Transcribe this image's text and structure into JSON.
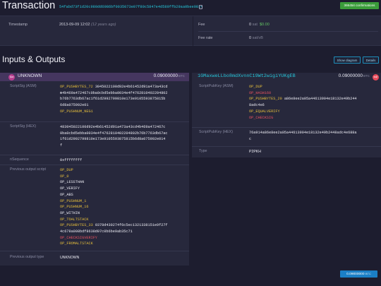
{
  "header": {
    "title": "Transaction",
    "txid": "54fabd73f1d20c980dd6986bf0035073e07f80c5847e4d589ffb29aa0bee9814",
    "confirmations": "366454 confirmations"
  },
  "summary": {
    "timestamp_label": "Timestamp",
    "timestamp_value": "2013-09-09 12:02",
    "timestamp_ago": "(12 years ago)",
    "fee_label": "Fee",
    "fee_sat": "0",
    "fee_sat_unit": "sat",
    "fee_usd": "$0.00",
    "fee_rate_label": "Fee rate",
    "fee_rate_value": "0",
    "fee_rate_unit": "sat/vB"
  },
  "io": {
    "title": "Inputs & Outputs",
    "show_diagram": "Show diagram",
    "details": "Details"
  },
  "input": {
    "label": "UNKNOWN",
    "amount": "0.09000000",
    "unit": "BTC",
    "scriptsig_asm_label": "ScriptSig (ASM)",
    "scriptsig_asm": [
      {
        "text": "OP_PUSHBYTES_72",
        "color": "yellow",
        "rest": " 3045022100d92e4b61452d91a473a43cd"
      },
      {
        "text": "",
        "color": "white",
        "rest": "m4b469a472467c0ba0cbd5ebba0034e4f4762810402204802"
      },
      {
        "text": "",
        "color": "white",
        "rest": "b76b7763db67ac1f61d2992799810e173e9105593875815b"
      },
      {
        "text": "",
        "color": "white",
        "rest": "6d8a075902e01"
      },
      {
        "text": "OP_PUSHNUM_NEG1",
        "color": "yellow",
        "rest": ""
      }
    ],
    "scriptsig_hex_label": "ScriptSig (HEX)",
    "scriptsig_hex": [
      "483045022100d92e4b61452d91a473a43cd4b469a472467c",
      "0ba0cbd5ebba0034e4f4762810402204802b76b7763db67ac",
      "1f61d2992799810e173e9105593875815b6d8a075902e014",
      "f"
    ],
    "nsequence_label": "nSequence",
    "nsequence": "0xffffffff",
    "prevout_label": "Previous output script",
    "prevout": [
      {
        "text": "OP_DUP",
        "color": "yellow",
        "rest": ""
      },
      {
        "text": "OP_0",
        "color": "yellow",
        "rest": ""
      },
      {
        "text": "OP_LESSTHAN",
        "color": "white",
        "rest": ""
      },
      {
        "text": "OP_VERIFY",
        "color": "white",
        "rest": ""
      },
      {
        "text": "OP_ABS",
        "color": "white",
        "rest": ""
      },
      {
        "text": "OP_PUSHNUM_1",
        "color": "yellow",
        "rest": ""
      },
      {
        "text": "OP_PUSHNUM_16",
        "color": "yellow",
        "rest": ""
      },
      {
        "text": "OP_WITHIN",
        "color": "white",
        "rest": ""
      },
      {
        "text": "OP_TOALTSTACK",
        "color": "yellow",
        "rest": ""
      },
      {
        "text": "OP_PUSHBYTES_33",
        "color": "yellow",
        "rest": " 0378d430274f6c5ec1321338151e9f27f"
      },
      {
        "text": "",
        "color": "white",
        "rest": "4c678a008bdf8638d07c0b6be9ab35c71"
      },
      {
        "text": "OP_CHECKSIGVERIFY",
        "color": "red",
        "rest": ""
      },
      {
        "text": "OP_FROMALTSTACK",
        "color": "yellow",
        "rest": ""
      }
    ],
    "prevout_type_label": "Previous output type",
    "prevout_type": "UNKNOWN"
  },
  "output": {
    "address": "1GMaxweLLbo8mdXvnnC19Wt2wigiYUKgEB",
    "amount": "0.09000000",
    "unit": "BTC",
    "spk_asm_label": "ScriptPubKey (ASM)",
    "spk_asm": [
      {
        "text": "OP_DUP",
        "color": "yellow",
        "rest": ""
      },
      {
        "text": "OP_HASH160",
        "color": "red",
        "rest": ""
      },
      {
        "text": "OP_PUSHBYTES_20",
        "color": "yellow",
        "rest": " a86e8ee2a05a44613904e18132e49b244"
      },
      {
        "text": "",
        "color": "white",
        "rest": "8adc4e6"
      },
      {
        "text": "OP_EQUALVERIFY",
        "color": "yellow",
        "rest": ""
      },
      {
        "text": "OP_CHECKSIG",
        "color": "red",
        "rest": ""
      }
    ],
    "spk_hex_label": "ScriptPubKey (HEX)",
    "spk_hex": [
      "76a914a86e8ee2a05a44613904e18132e49b2448adc4e688a",
      "c"
    ],
    "type_label": "Type",
    "type": "P2PKH"
  },
  "footer": {
    "total": "0.09000000",
    "total_unit": "BTC"
  },
  "colors": {
    "yellow": "#e4bd3b",
    "red": "#e85260",
    "white": "#ebebf3",
    "accent": "#26c6da",
    "panel": "#27283c",
    "background": "#1d1d2f"
  }
}
